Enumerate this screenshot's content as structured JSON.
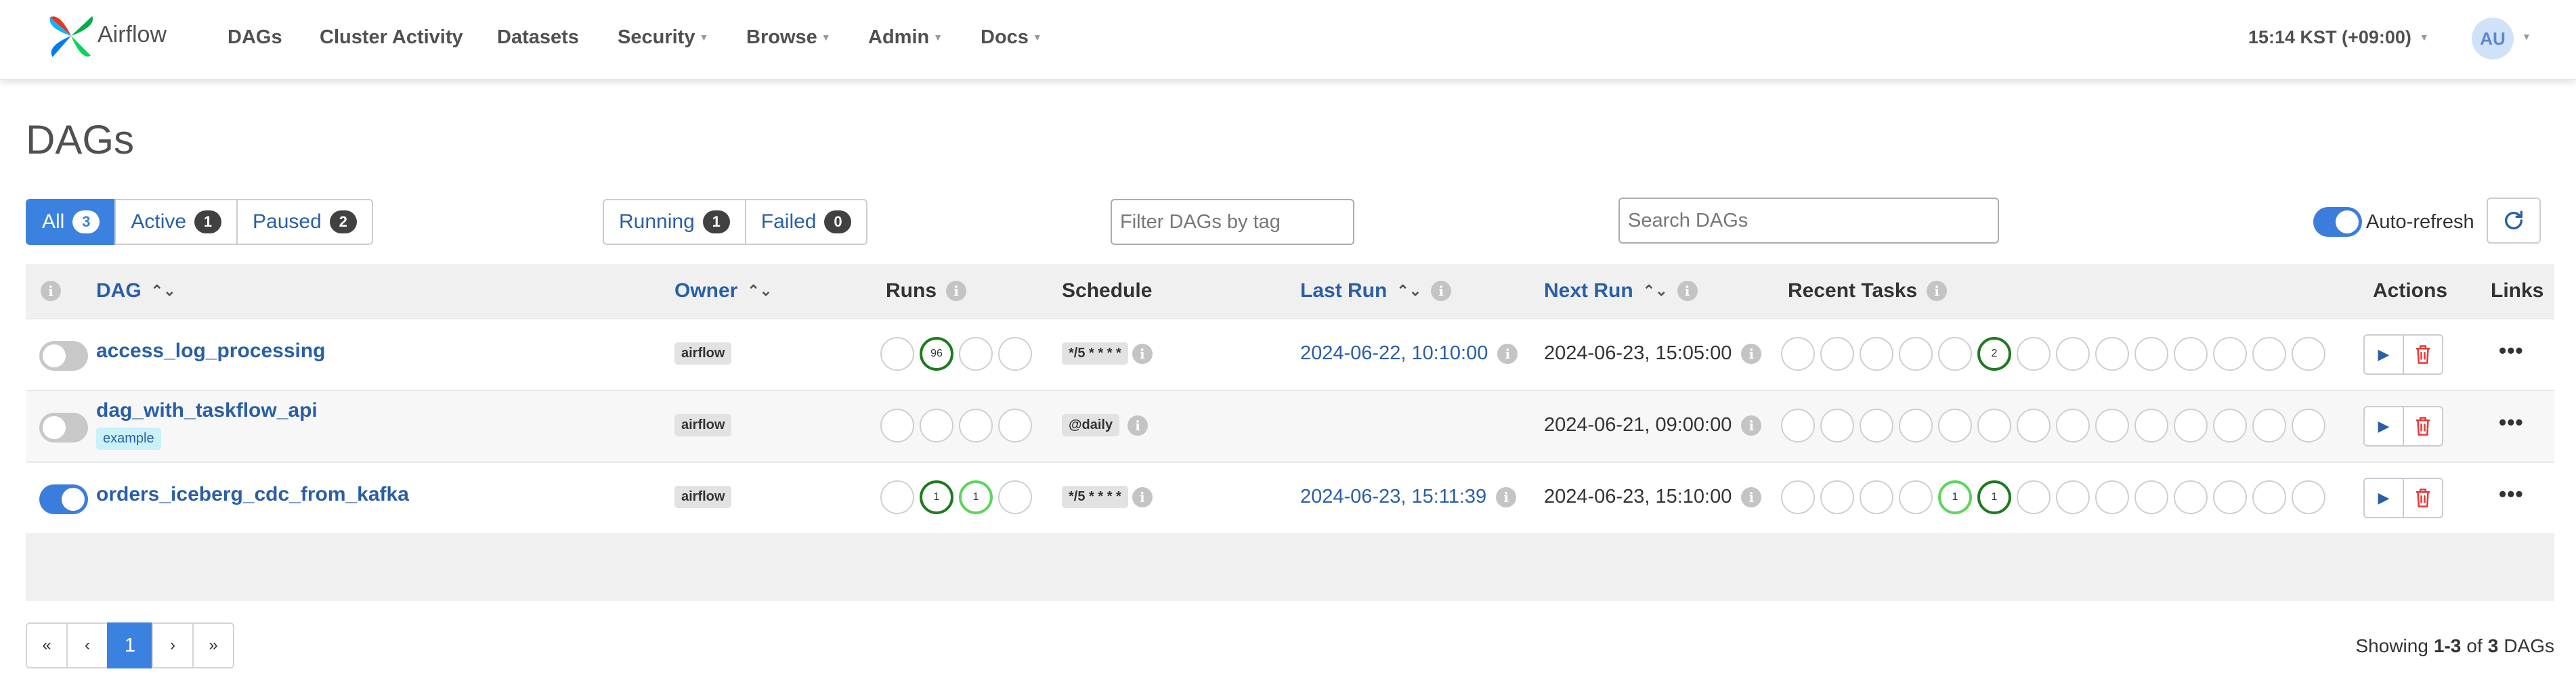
{
  "brand": {
    "name": "Airflow"
  },
  "nav": {
    "items": [
      {
        "label": "DAGs"
      },
      {
        "label": "Cluster Activity"
      },
      {
        "label": "Datasets"
      },
      {
        "label": "Security"
      },
      {
        "label": "Browse"
      },
      {
        "label": "Admin"
      },
      {
        "label": "Docs"
      }
    ],
    "time": "15:14 KST (+09:00)",
    "user_initials": "AU"
  },
  "page": {
    "title": "DAGs"
  },
  "filters": {
    "all": {
      "label": "All",
      "count": "3"
    },
    "active": {
      "label": "Active",
      "count": "1"
    },
    "paused": {
      "label": "Paused",
      "count": "2"
    },
    "running": {
      "label": "Running",
      "count": "1"
    },
    "failed": {
      "label": "Failed",
      "count": "0"
    },
    "tag_placeholder": "Filter DAGs by tag",
    "search_placeholder": "Search DAGs",
    "auto_refresh_label": "Auto-refresh",
    "auto_refresh_on": true
  },
  "table": {
    "columns": {
      "dag": "DAG",
      "owner": "Owner",
      "runs": "Runs",
      "schedule": "Schedule",
      "last_run": "Last Run",
      "next_run": "Next Run",
      "recent_tasks": "Recent Tasks",
      "actions": "Actions",
      "links": "Links"
    },
    "rows": [
      {
        "dag_id": "access_log_processing",
        "paused": true,
        "tags": [],
        "owner": "airflow",
        "runs": [
          "",
          "96",
          "",
          ""
        ],
        "runs_state": [
          "",
          "success",
          "",
          ""
        ],
        "schedule": "*/5 * * * *",
        "last_run": "2024-06-22, 10:10:00",
        "next_run": "2024-06-23, 15:05:00",
        "recent_tasks": [
          "",
          "",
          "",
          "",
          "",
          "2",
          "",
          "",
          "",
          "",
          "",
          "",
          "",
          ""
        ],
        "recent_tasks_state": [
          "",
          "",
          "",
          "",
          "",
          "success",
          "",
          "",
          "",
          "",
          "",
          "",
          "",
          ""
        ]
      },
      {
        "dag_id": "dag_with_taskflow_api",
        "paused": true,
        "tags": [
          "example"
        ],
        "owner": "airflow",
        "runs": [
          "",
          "",
          "",
          ""
        ],
        "runs_state": [
          "",
          "",
          "",
          ""
        ],
        "schedule": "@daily",
        "last_run": "",
        "next_run": "2024-06-21, 09:00:00",
        "recent_tasks": [
          "",
          "",
          "",
          "",
          "",
          "",
          "",
          "",
          "",
          "",
          "",
          "",
          "",
          ""
        ],
        "recent_tasks_state": [
          "",
          "",
          "",
          "",
          "",
          "",
          "",
          "",
          "",
          "",
          "",
          "",
          "",
          ""
        ]
      },
      {
        "dag_id": "orders_iceberg_cdc_from_kafka",
        "paused": false,
        "tags": [],
        "owner": "airflow",
        "runs": [
          "",
          "1",
          "1",
          ""
        ],
        "runs_state": [
          "",
          "success",
          "running",
          ""
        ],
        "schedule": "*/5 * * * *",
        "last_run": "2024-06-23, 15:11:39",
        "next_run": "2024-06-23, 15:10:00",
        "recent_tasks": [
          "",
          "",
          "",
          "",
          "1",
          "1",
          "",
          "",
          "",
          "",
          "",
          "",
          "",
          ""
        ],
        "recent_tasks_state": [
          "",
          "",
          "",
          "",
          "running",
          "success",
          "",
          "",
          "",
          "",
          "",
          "",
          "",
          ""
        ]
      }
    ]
  },
  "pagination": {
    "first": "«",
    "prev": "‹",
    "current": "1",
    "next": "›",
    "last": "»",
    "showing_prefix": "Showing",
    "range": "1-3",
    "of": "of",
    "total": "3",
    "suffix": "DAGs"
  },
  "colors": {
    "accent": "#3b82e0",
    "link": "#2a5fa6",
    "success": "#1f7a1f",
    "running": "#5cd65c",
    "danger": "#e53935"
  },
  "icons": {
    "logo": "airflow-pinwheel-icon",
    "info": "info-icon",
    "sort": "sort-icon",
    "play": "play-icon",
    "delete": "trash-icon",
    "refresh": "refresh-icon",
    "links": "more-dots-icon"
  }
}
